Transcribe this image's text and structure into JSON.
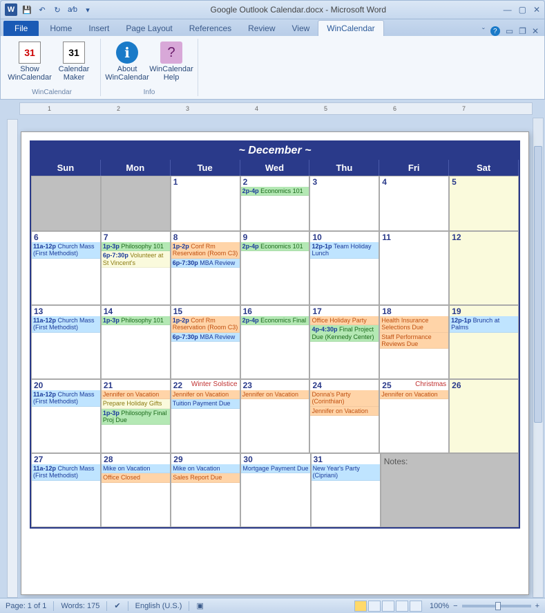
{
  "window": {
    "title": "Google Outlook Calendar.docx  -  Microsoft Word",
    "app_icon": "W"
  },
  "qat": {
    "save": "💾",
    "undo": "↶",
    "redo": "↻",
    "ab": "a⁄b",
    "dropdown": "▾"
  },
  "tabs": {
    "file": "File",
    "home": "Home",
    "insert": "Insert",
    "page_layout": "Page Layout",
    "references": "References",
    "review": "Review",
    "view": "View",
    "wincalendar": "WinCalendar"
  },
  "help_icons": {
    "caret": "ˇ",
    "q": "?",
    "min": "▭",
    "restore": "❐",
    "close": "✕"
  },
  "ribbon": {
    "g1": {
      "name": "WinCalendar",
      "btn1": {
        "label": "Show WinCalendar",
        "icon": "31"
      },
      "btn2": {
        "label": "Calendar Maker",
        "icon": "31"
      }
    },
    "g2": {
      "name": "Info",
      "btn1": {
        "label": "About WinCalendar",
        "icon": "ℹ"
      },
      "btn2": {
        "label": "WinCalendar Help",
        "icon": "?"
      }
    }
  },
  "ruler_marks": [
    "1",
    "2",
    "3",
    "4",
    "5",
    "6",
    "7"
  ],
  "calendar": {
    "title": "~ December ~",
    "days": [
      "Sun",
      "Mon",
      "Tue",
      "Wed",
      "Thu",
      "Fri",
      "Sat"
    ],
    "weeks": [
      [
        {
          "grey": true
        },
        {
          "grey": true
        },
        {
          "num": "1"
        },
        {
          "num": "2",
          "events": [
            {
              "c": "green",
              "tm": "2p-4p",
              "txt": "Economics 101"
            }
          ]
        },
        {
          "num": "3"
        },
        {
          "num": "4"
        },
        {
          "num": "5",
          "cream": true
        }
      ],
      [
        {
          "num": "6",
          "events": [
            {
              "c": "blue",
              "tm": "11a-12p",
              "txt": "Church Mass (First Methodist)"
            }
          ]
        },
        {
          "num": "7",
          "events": [
            {
              "c": "green",
              "tm": "1p-3p",
              "txt": "Philosophy 101"
            },
            {
              "c": "yellow",
              "tm": "6p-7:30p",
              "txt": "Volunteer at St Vincent's"
            }
          ]
        },
        {
          "num": "8",
          "events": [
            {
              "c": "orange",
              "tm": "1p-2p",
              "txt": "Conf Rm Reservation (Room C3)"
            },
            {
              "c": "blue",
              "tm": "6p-7:30p",
              "txt": "MBA Review"
            }
          ]
        },
        {
          "num": "9",
          "events": [
            {
              "c": "green",
              "tm": "2p-4p",
              "txt": "Economics 101"
            }
          ]
        },
        {
          "num": "10",
          "events": [
            {
              "c": "blue",
              "tm": "12p-1p",
              "txt": "Team Holiday Lunch"
            }
          ]
        },
        {
          "num": "11"
        },
        {
          "num": "12",
          "cream": true
        }
      ],
      [
        {
          "num": "13",
          "events": [
            {
              "c": "blue",
              "tm": "11a-12p",
              "txt": "Church Mass (First Methodist)"
            }
          ]
        },
        {
          "num": "14",
          "events": [
            {
              "c": "green",
              "tm": "1p-3p",
              "txt": "Philosophy 101"
            }
          ]
        },
        {
          "num": "15",
          "events": [
            {
              "c": "orange",
              "tm": "1p-2p",
              "txt": "Conf Rm Reservation (Room C3)"
            },
            {
              "c": "blue",
              "tm": "6p-7:30p",
              "txt": "MBA Review"
            }
          ]
        },
        {
          "num": "16",
          "events": [
            {
              "c": "green",
              "tm": "2p-4p",
              "txt": "Economics Final"
            }
          ]
        },
        {
          "num": "17",
          "events": [
            {
              "c": "orange",
              "tm": "",
              "txt": "Office Holiday Party"
            },
            {
              "c": "green",
              "tm": "4p-4:30p",
              "txt": "Final Project Due (Kennedy Center)"
            }
          ]
        },
        {
          "num": "18",
          "events": [
            {
              "c": "orange",
              "tm": "",
              "txt": "Health Insurance Selections Due"
            },
            {
              "c": "orange",
              "tm": "",
              "txt": "Staff Performance Reviews Due"
            }
          ]
        },
        {
          "num": "19",
          "cream": true,
          "events": [
            {
              "c": "blue",
              "tm": "12p-1p",
              "txt": "Brunch at Palms"
            }
          ]
        }
      ],
      [
        {
          "num": "20",
          "events": [
            {
              "c": "blue",
              "tm": "11a-12p",
              "txt": "Church Mass (First Methodist)"
            }
          ]
        },
        {
          "num": "21",
          "events": [
            {
              "c": "orange",
              "tm": "",
              "txt": "Jennifer on Vacation"
            },
            {
              "c": "yellow",
              "tm": "",
              "txt": "Prepare Holiday Gifts"
            },
            {
              "c": "green",
              "tm": "1p-3p",
              "txt": "Philosophy Final Proj Due"
            }
          ]
        },
        {
          "num": "22",
          "holiday": "Winter Solstice",
          "events": [
            {
              "c": "orange",
              "tm": "",
              "txt": "Jennifer on Vacation"
            },
            {
              "c": "blue",
              "tm": "",
              "txt": "Tuition Payment Due"
            }
          ]
        },
        {
          "num": "23",
          "events": [
            {
              "c": "orange",
              "tm": "",
              "txt": "Jennifer on Vacation"
            }
          ]
        },
        {
          "num": "24",
          "events": [
            {
              "c": "orange",
              "tm": "",
              "txt": "Donna's Party (Corinthian)"
            },
            {
              "c": "orange",
              "tm": "",
              "txt": "Jennifer on Vacation"
            }
          ]
        },
        {
          "num": "25",
          "holiday": "Christmas",
          "events": [
            {
              "c": "orange",
              "tm": "",
              "txt": "Jennifer on Vacation"
            }
          ]
        },
        {
          "num": "26",
          "cream": true
        }
      ],
      [
        {
          "num": "27",
          "events": [
            {
              "c": "blue",
              "tm": "11a-12p",
              "txt": "Church Mass (First Methodist)"
            }
          ]
        },
        {
          "num": "28",
          "events": [
            {
              "c": "blue",
              "tm": "",
              "txt": "Mike on Vacation"
            },
            {
              "c": "orange",
              "tm": "",
              "txt": "Office Closed"
            }
          ]
        },
        {
          "num": "29",
          "events": [
            {
              "c": "blue",
              "tm": "",
              "txt": "Mike on Vacation"
            },
            {
              "c": "orange",
              "tm": "",
              "txt": "Sales Report Due"
            }
          ]
        },
        {
          "num": "30",
          "events": [
            {
              "c": "blue",
              "tm": "",
              "txt": "Mortgage Payment Due"
            }
          ]
        },
        {
          "num": "31",
          "events": [
            {
              "c": "blue",
              "tm": "",
              "txt": "New Year's Party (Cipriani)"
            }
          ]
        },
        {
          "num": "",
          "grey": true,
          "notes": "Notes:",
          "span": 2
        }
      ]
    ]
  },
  "status": {
    "page": "Page: 1 of 1",
    "words": "Words: 175",
    "lang": "English (U.S.)",
    "zoom": "100%",
    "minus": "−",
    "plus": "+"
  }
}
